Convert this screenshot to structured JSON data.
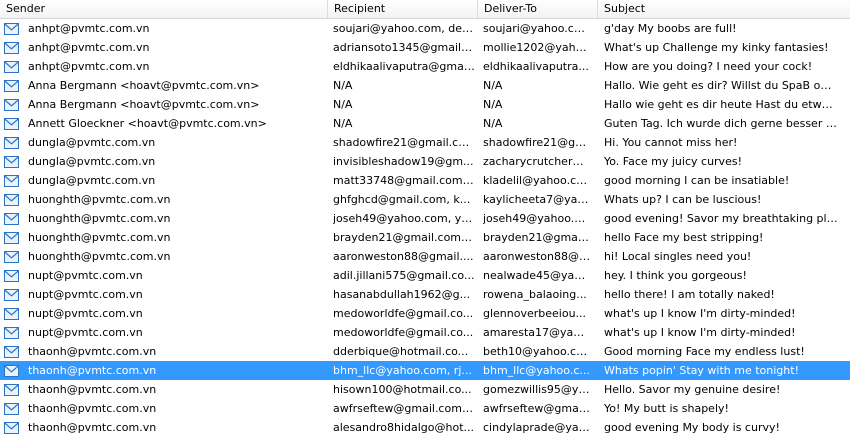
{
  "columns": {
    "sender": "Sender",
    "recipient": "Recipient",
    "deliver_to": "Deliver-To",
    "subject": "Subject"
  },
  "selected_row_index": 18,
  "rows": [
    {
      "sender": "anhpt@pvmtc.com.vn",
      "recipient": "soujari@yahoo.com, der...",
      "deliver_to": "soujari@yahoo.com",
      "subject": "g'day My boobs are full!"
    },
    {
      "sender": "anhpt@pvmtc.com.vn",
      "recipient": "adriansoto1345@gmail....",
      "deliver_to": "mollie1202@yaho...",
      "subject": "What's up Challenge my kinky fantasies!"
    },
    {
      "sender": "anhpt@pvmtc.com.vn",
      "recipient": "eldhikaalivaputra@gmai...",
      "deliver_to": "eldhikaalivaputra...",
      "subject": "How are you doing? I need your cock!"
    },
    {
      "sender": "Anna Bergmann <hoavt@pvmtc.com.vn>",
      "recipient": "N/A",
      "deliver_to": "N/A",
      "subject": "Hallo. Wie geht es dir? Willst du SpaB onlin..."
    },
    {
      "sender": "Anna Bergmann <hoavt@pvmtc.com.vn>",
      "recipient": "N/A",
      "deliver_to": "N/A",
      "subject": "Hallo wie geht es dir heute Hast du etwas d..."
    },
    {
      "sender": "Annett Gloeckner <hoavt@pvmtc.com.vn>",
      "recipient": "N/A",
      "deliver_to": "N/A",
      "subject": "Guten Tag. Ich wurde dich gerne besser ke..."
    },
    {
      "sender": "dungla@pvmtc.com.vn",
      "recipient": "shadowfire21@gmail.co...",
      "deliver_to": "shadowfire21@gm...",
      "subject": "Hi. You cannot miss her!"
    },
    {
      "sender": "dungla@pvmtc.com.vn",
      "recipient": "invisibleshadow19@gm...",
      "deliver_to": "zacharycrutcher@...",
      "subject": "Yo. Face my juicy curves!"
    },
    {
      "sender": "dungla@pvmtc.com.vn",
      "recipient": "matt33748@gmail.com, ...",
      "deliver_to": "kladelil@yahoo.com",
      "subject": "good morning I can be insatiable!"
    },
    {
      "sender": "huonghth@pvmtc.com.vn",
      "recipient": "ghfghcd@gmail.com, k...",
      "deliver_to": "kaylicheeta7@yah...",
      "subject": "Whats up? I can be luscious!"
    },
    {
      "sender": "huonghth@pvmtc.com.vn",
      "recipient": "joseh49@yahoo.com, ya...",
      "deliver_to": "joseh49@yahoo.c...",
      "subject": "good evening! Savor my breathtaking playf..."
    },
    {
      "sender": "huonghth@pvmtc.com.vn",
      "recipient": "brayden21@gmail.com, ...",
      "deliver_to": "brayden21@gmail....",
      "subject": "hello Face my best stripping!"
    },
    {
      "sender": "huonghth@pvmtc.com.vn",
      "recipient": "aaronweston88@gmail....",
      "deliver_to": "aaronweston88@g...",
      "subject": "hi! Local singles need you!"
    },
    {
      "sender": "nupt@pvmtc.com.vn",
      "recipient": "adil.jillani575@gmail.co...",
      "deliver_to": "nealwade45@yaho...",
      "subject": "hey. I think you gorgeous!"
    },
    {
      "sender": "nupt@pvmtc.com.vn",
      "recipient": "hasanabdullah1962@g...",
      "deliver_to": "rowena_balaoing...",
      "subject": "hello there! I am totally naked!"
    },
    {
      "sender": "nupt@pvmtc.com.vn",
      "recipient": "medoworldfe@gmail.co...",
      "deliver_to": "glennoverbeeiou...",
      "subject": "what's up I know I'm dirty-minded!"
    },
    {
      "sender": "nupt@pvmtc.com.vn",
      "recipient": "medoworldfe@gmail.co...",
      "deliver_to": "amaresta17@yaho...",
      "subject": "what's up I know I'm dirty-minded!"
    },
    {
      "sender": "thaonh@pvmtc.com.vn",
      "recipient": "dderbique@hotmail.co...",
      "deliver_to": "beth10@yahoo.com",
      "subject": "Good morning Face my endless lust!"
    },
    {
      "sender": "thaonh@pvmtc.com.vn",
      "recipient": "bhm_llc@yahoo.com, rj...",
      "deliver_to": "bhm_llc@yahoo.c...",
      "subject": "Whats popin' Stay with me tonight!"
    },
    {
      "sender": "thaonh@pvmtc.com.vn",
      "recipient": "hisown100@hotmail.co...",
      "deliver_to": "gomezwillis95@ya...",
      "subject": "Hello. Savor my genuine desire!"
    },
    {
      "sender": "thaonh@pvmtc.com.vn",
      "recipient": "awfrseftew@gmail.com,...",
      "deliver_to": "awfrseftew@gmail...",
      "subject": "Yo! My butt is shapely!"
    },
    {
      "sender": "thaonh@pvmtc.com.vn",
      "recipient": "alesandro8hidalgo@hot...",
      "deliver_to": "cindylaprade@yah...",
      "subject": "good evening My body is curvy!"
    }
  ],
  "icon": "envelope-icon",
  "colors": {
    "selection": "#3399ff",
    "icon_blue": "#2a73c9"
  }
}
